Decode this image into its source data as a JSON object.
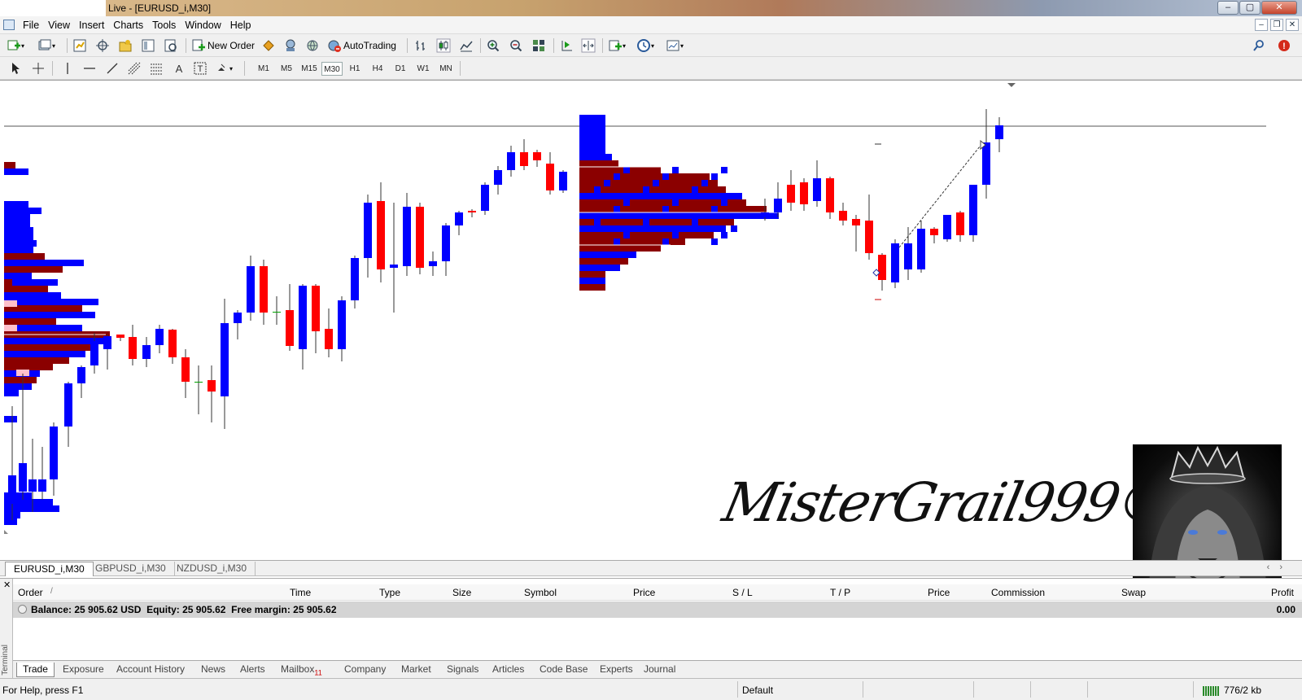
{
  "window": {
    "title": "Live - [EURUSD_i,M30]",
    "min": "–",
    "max": "▢",
    "close": "✕"
  },
  "menu": [
    {
      "label": "File"
    },
    {
      "label": "View"
    },
    {
      "label": "Insert"
    },
    {
      "label": "Charts"
    },
    {
      "label": "Tools"
    },
    {
      "label": "Window"
    },
    {
      "label": "Help"
    }
  ],
  "toolbar": {
    "new_order": "New Order",
    "autotrading": "AutoTrading"
  },
  "timeframes": [
    "M1",
    "M5",
    "M15",
    "M30",
    "H1",
    "H4",
    "D1",
    "W1",
    "MN"
  ],
  "active_timeframe": "M30",
  "chart": {
    "watermark": "MisterGrail999©",
    "bull_color": "#0000ff",
    "bear_color": "#ff0000",
    "neutral_color": "#00a000",
    "profile_dark": "#8b0000"
  },
  "chart_tabs": [
    "EURUSD_i,M30",
    "GBPUSD_i,M30",
    "NZDUSD_i,M30"
  ],
  "terminal": {
    "side_label": "Terminal",
    "columns": [
      "Order",
      "Time",
      "Type",
      "Size",
      "Symbol",
      "Price",
      "S / L",
      "T / P",
      "Price",
      "Commission",
      "Swap",
      "Profit"
    ],
    "balance_text": "Balance: 25 905.62 USD  Equity: 25 905.62  Free margin: 25 905.62",
    "profit": "0.00",
    "tabs": [
      "Trade",
      "Exposure",
      "Account History",
      "News",
      "Alerts",
      "Mailbox",
      "Company",
      "Market",
      "Signals",
      "Articles",
      "Code Base",
      "Experts",
      "Journal"
    ],
    "mailbox_badge": "11"
  },
  "status": {
    "help": "For Help, press F1",
    "profile": "Default",
    "connection": "776/2 kb"
  }
}
